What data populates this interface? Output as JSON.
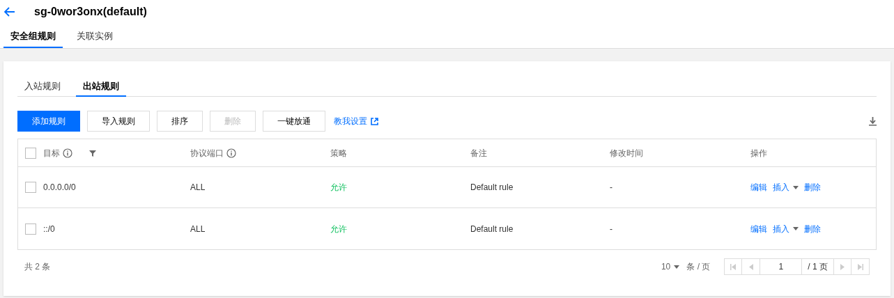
{
  "header": {
    "title": "sg-0wor3onx(default)"
  },
  "tabs": [
    {
      "label": "安全组规则",
      "selected": true
    },
    {
      "label": "关联实例",
      "selected": false
    }
  ],
  "subtabs": [
    {
      "label": "入站规则",
      "selected": false
    },
    {
      "label": "出站规则",
      "selected": true
    }
  ],
  "toolbar": {
    "buttons": [
      {
        "label": "添加规则",
        "kind": "primary",
        "disabled": false
      },
      {
        "label": "导入规则",
        "kind": "default",
        "disabled": false
      },
      {
        "label": "排序",
        "kind": "default",
        "disabled": false
      },
      {
        "label": "删除",
        "kind": "default",
        "disabled": true
      },
      {
        "label": "一键放通",
        "kind": "default",
        "disabled": false
      }
    ],
    "help_link": "教我设置"
  },
  "table": {
    "select_all_checked": false,
    "columns": [
      {
        "label": "目标",
        "info": true,
        "filter": true
      },
      {
        "label": "协议端口",
        "info": true,
        "filter": false
      },
      {
        "label": "策略",
        "info": false,
        "filter": false
      },
      {
        "label": "备注",
        "info": false,
        "filter": false
      },
      {
        "label": "修改时间",
        "info": false,
        "filter": false
      },
      {
        "label": "操作",
        "info": false,
        "filter": false
      }
    ],
    "rows": [
      {
        "checked": false,
        "target": "0.0.0.0/0",
        "port": "ALL",
        "policy": "允许",
        "note": "Default rule",
        "time": "-",
        "actions": [
          "编辑",
          "插入",
          "删除"
        ]
      },
      {
        "checked": false,
        "target": "::/0",
        "port": "ALL",
        "policy": "允许",
        "note": "Default rule",
        "time": "-",
        "actions": [
          "编辑",
          "插入",
          "删除"
        ]
      }
    ]
  },
  "footer": {
    "total": "共 2 条",
    "page_size": "10",
    "page_size_unit": "条 / 页",
    "page": "1",
    "page_total": "/ 1 页"
  }
}
